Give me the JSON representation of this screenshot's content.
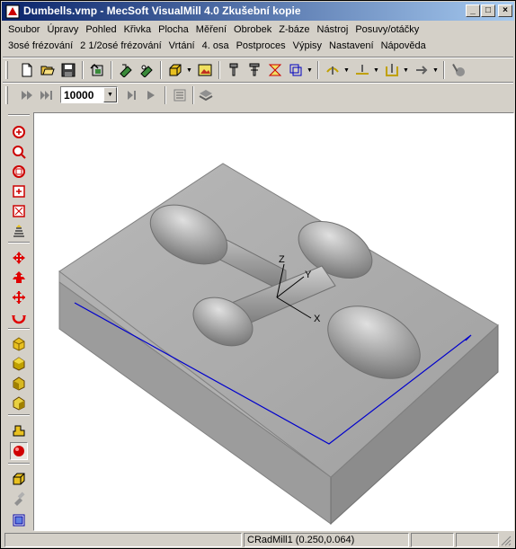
{
  "window": {
    "title": "Dumbells.vmp - MecSoft  VisualMill 4.0 Zkušební kopie",
    "minimize": "_",
    "maximize": "□",
    "close": "×"
  },
  "menu": {
    "row1": [
      "Soubor",
      "Úpravy",
      "Pohled",
      "Křivka",
      "Plocha",
      "Měření",
      "Obrobek",
      "Z-báze",
      "Nástroj",
      "Posuvy/otáčky"
    ],
    "row2": [
      "3osé frézování",
      "2 1/2osé frézování",
      "Vrtání",
      "4. osa",
      "Postproces",
      "Výpisy",
      "Nastavení",
      "Nápověda"
    ]
  },
  "toolbar2": {
    "step_value": "10000"
  },
  "viewport": {
    "axes": {
      "x": "X",
      "y": "Y",
      "z": "Z"
    },
    "boundary_color": "#0000cc",
    "part_color": "#a8a8a8"
  },
  "status": {
    "pane1": "",
    "pane2": "CRadMill1 (0.250,0.064)",
    "pane3": ""
  },
  "icons": {
    "toolbar1": [
      "new-file-icon",
      "open-file-icon",
      "save-icon",
      "import-icon",
      "mill-setup-icon",
      "machine-setup-icon",
      "stock-box-icon",
      "image-icon",
      "tool-icon",
      "tool-library-icon",
      "feeds-icon",
      "coordinate-system-icon",
      "surface-select-icon",
      "curve-select-icon",
      "drill-icon",
      "simulate-icon",
      "cut-material-icon"
    ],
    "toolbar2": [
      "play-icon",
      "fast-forward-icon",
      "step-icon",
      "pause-icon",
      "toolpath-list-icon",
      "layer-icon"
    ],
    "left": [
      "zoom-in-icon",
      "zoom-out-icon",
      "zoom-window-icon",
      "zoom-extents-icon",
      "zoom-fit-icon",
      "view-front-icon",
      "pan-icon",
      "rotate-icon",
      "move-icon",
      "spin-icon",
      "iso-view-1-icon",
      "iso-view-2-icon",
      "iso-view-3-icon",
      "iso-view-4-icon",
      "shaded-icon",
      "render-ball-icon",
      "box-view-icon",
      "tool-view-icon",
      "grid-icon"
    ]
  }
}
